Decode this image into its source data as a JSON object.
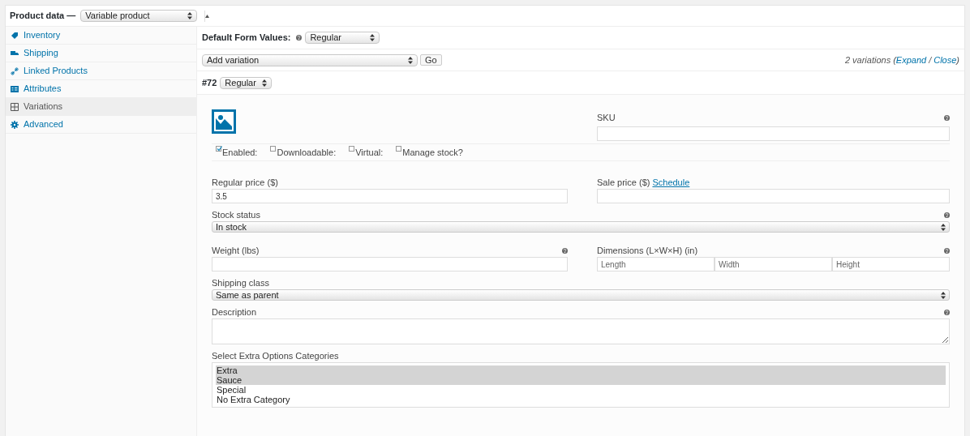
{
  "header": {
    "title": "Product data —",
    "product_type": "Variable product"
  },
  "tabs": [
    {
      "label": "Inventory",
      "kind": "tag",
      "selected": false
    },
    {
      "label": "Shipping",
      "kind": "truck",
      "selected": false
    },
    {
      "label": "Linked Products",
      "kind": "link",
      "selected": false
    },
    {
      "label": "Attributes",
      "kind": "card",
      "selected": false
    },
    {
      "label": "Variations",
      "kind": "grid",
      "selected": true
    },
    {
      "label": "Advanced",
      "kind": "gear",
      "selected": false
    }
  ],
  "default_form": {
    "label": "Default Form Values:",
    "value": "Regular"
  },
  "bulk": {
    "action": "Add variation",
    "button": "Go",
    "count": "2 variations",
    "open_paren": "(",
    "expand": "Expand",
    "slash": "/",
    "close": "Close",
    "close_paren": ")"
  },
  "variation": {
    "number": "#72",
    "type": "Regular",
    "sku_label": "SKU",
    "options": [
      {
        "label": "Enabled:",
        "checked": true
      },
      {
        "label": "Downloadable:",
        "checked": false
      },
      {
        "label": "Virtual:",
        "checked": false
      },
      {
        "label": "Manage stock?",
        "checked": false
      }
    ],
    "regular_price_label": "Regular price ($)",
    "regular_price": "3.5",
    "sale_price_label": "Sale price ($)",
    "schedule_link": "Schedule",
    "stock_status_label": "Stock status",
    "stock_status": "In stock",
    "weight_label": "Weight (lbs)",
    "dimensions_label": "Dimensions (L×W×H) (in)",
    "dimension_placeholders": [
      "Length",
      "Width",
      "Height"
    ],
    "shipping_class_label": "Shipping class",
    "shipping_class": "Same as parent",
    "description_label": "Description",
    "extra_label": "Select Extra Options Categories",
    "extra_options": [
      {
        "label": "Extra",
        "selected": true
      },
      {
        "label": "Sauce",
        "selected": true
      },
      {
        "label": "Special",
        "selected": false
      },
      {
        "label": "No Extra Category",
        "selected": false
      }
    ]
  }
}
